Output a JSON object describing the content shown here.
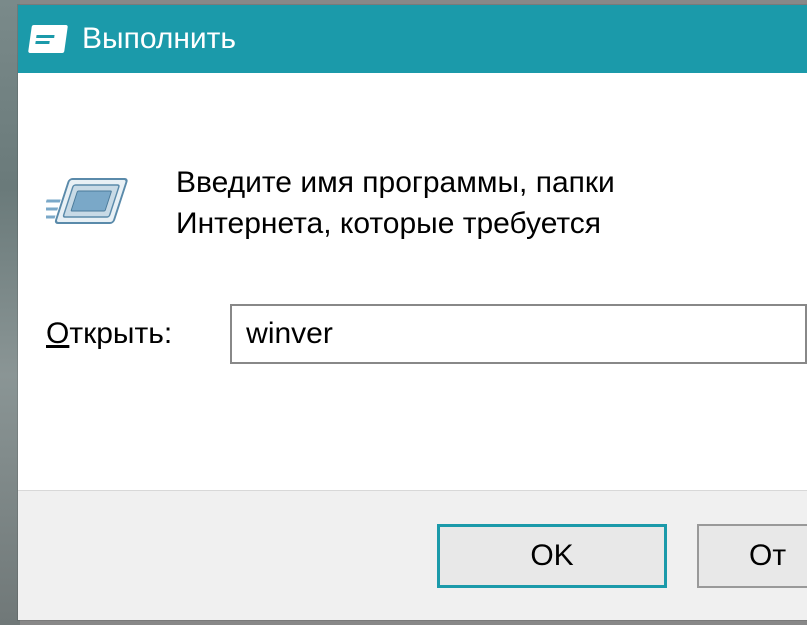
{
  "titlebar": {
    "title": "Выполнить"
  },
  "content": {
    "intro_line1": "Введите имя программы, папки",
    "intro_line2": "Интернета, которые требуется",
    "open_label_underlined": "О",
    "open_label_rest": "ткрыть:",
    "input_value": "winver"
  },
  "buttons": {
    "ok": "OK",
    "cancel": "От"
  },
  "colors": {
    "accent": "#1b9aaa",
    "button_bg": "#e8e8e8",
    "button_bar_bg": "#f0f0f0"
  }
}
